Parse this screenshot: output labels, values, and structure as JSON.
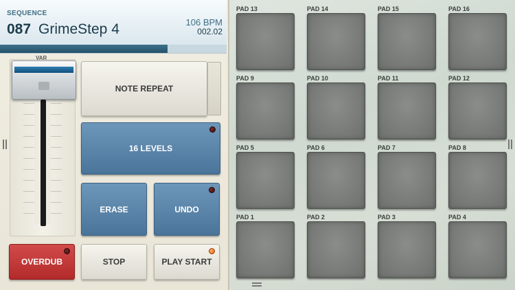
{
  "display": {
    "sequence_label": "SEQUENCE",
    "sequence_number": "087",
    "sequence_name": "GrimeStep 4",
    "bpm": "106 BPM",
    "position": "002.02",
    "progress_percent": 74
  },
  "slider": {
    "label": "VAR"
  },
  "buttons": {
    "note_repeat": "NOTE REPEAT",
    "levels_16": "16 LEVELS",
    "erase": "ERASE",
    "undo": "UNDO",
    "overdub": "OVERDUB",
    "stop": "STOP",
    "play_start": "PLAY START"
  },
  "pads": [
    {
      "label": "PAD 13"
    },
    {
      "label": "PAD 14"
    },
    {
      "label": "PAD 15"
    },
    {
      "label": "PAD 16"
    },
    {
      "label": "PAD 9"
    },
    {
      "label": "PAD 10"
    },
    {
      "label": "PAD 11"
    },
    {
      "label": "PAD 12"
    },
    {
      "label": "PAD 5"
    },
    {
      "label": "PAD 6"
    },
    {
      "label": "PAD 7"
    },
    {
      "label": "PAD 8"
    },
    {
      "label": "PAD 1"
    },
    {
      "label": "PAD 2"
    },
    {
      "label": "PAD 3"
    },
    {
      "label": "PAD 4"
    }
  ],
  "colors": {
    "accent_blue": "#4a7499",
    "overdub_red": "#c03636",
    "pad_gray": "#7a7d7a",
    "display_text": "#1d3b4c"
  },
  "icons": {
    "left_grip": "grip-handle-icon",
    "right_grip": "grip-handle-icon",
    "bottom_grip": "grip-handle-icon",
    "led": "led-indicator-icon"
  }
}
